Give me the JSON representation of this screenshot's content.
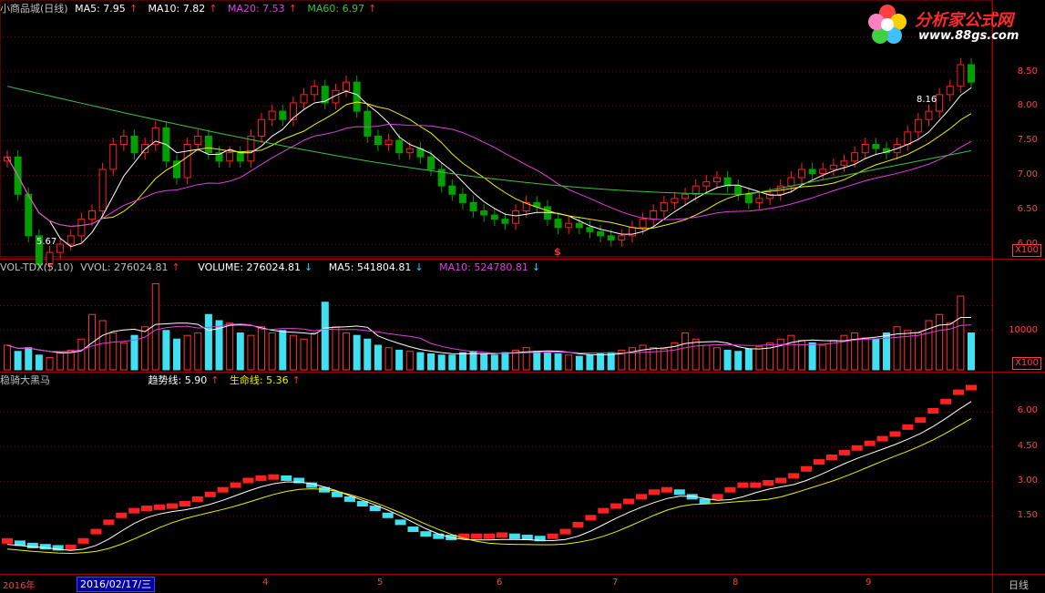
{
  "header": {
    "title": "小商品城(日线)",
    "ma5": "MA5: 7.95",
    "ma10": "MA10: 7.82",
    "ma20": "MA20: 7.53",
    "ma60": "MA60: 6.97",
    "arrow": "↑"
  },
  "logo": {
    "name": "分析家公式网",
    "url": "www.88gs.com"
  },
  "price_panel": {
    "y_ticks": [
      "8.50",
      "8.00",
      "7.50",
      "7.00",
      "6.50",
      "6.00"
    ],
    "high_label": "8.16",
    "low_label": "5.67",
    "marker": "$",
    "scale": "X100"
  },
  "volume_panel": {
    "title": "VOL-TDX(5,10)",
    "vvol": "VVOL: 276024.81",
    "volume": "VOLUME: 276024.81",
    "ma5": "MA5: 541804.81",
    "ma10": "MA10: 524780.81",
    "arrow_up": "↑",
    "arrow_down": "↓",
    "y_tick": "10000",
    "scale": "X100"
  },
  "indicator_panel": {
    "title": "稳骑大黑马",
    "trend": "趋势线: 5.90",
    "life": "生命线: 5.36",
    "arrow": "↑",
    "y_ticks": [
      "6.00",
      "4.50",
      "3.00",
      "1.50"
    ]
  },
  "x_axis": {
    "year": "2016年",
    "cursor_date": "2016/02/17/三",
    "months": [
      "4",
      "5",
      "6",
      "7",
      "8",
      "9"
    ],
    "period": "日线"
  },
  "colors": {
    "up": "#ff2020",
    "down": "#00a000",
    "vol_up": "#ff3030",
    "vol_down": "#40e0f0",
    "ma5": "#ffffff",
    "ma10": "#f0f000",
    "ma20": "#e040e0",
    "ma60": "#40c040",
    "grid": "#800000",
    "ind_up": "#ff2020",
    "ind_down": "#40e0f0"
  },
  "chart_data": {
    "type": "candlestick",
    "title": "小商品城(日线)",
    "ylim": [
      5.5,
      8.7
    ],
    "x_start": "2016-02",
    "x_end": "2016-09",
    "key_points": [
      {
        "label": "low",
        "value": 5.67
      },
      {
        "label": "high",
        "value": 8.16
      }
    ],
    "close_series": [
      7.05,
      6.6,
      6.1,
      5.75,
      5.9,
      6.0,
      6.1,
      6.3,
      6.4,
      6.9,
      7.2,
      7.3,
      7.1,
      7.2,
      7.4,
      7.0,
      6.8,
      7.2,
      7.3,
      7.1,
      7.0,
      7.1,
      7.0,
      7.3,
      7.5,
      7.6,
      7.5,
      7.7,
      7.8,
      7.9,
      7.7,
      7.85,
      7.95,
      7.6,
      7.3,
      7.2,
      7.25,
      7.1,
      7.15,
      7.05,
      6.9,
      6.7,
      6.6,
      6.5,
      6.4,
      6.35,
      6.3,
      6.25,
      6.4,
      6.5,
      6.45,
      6.3,
      6.2,
      6.25,
      6.2,
      6.15,
      6.1,
      6.05,
      6.1,
      6.2,
      6.3,
      6.4,
      6.5,
      6.55,
      6.6,
      6.7,
      6.75,
      6.8,
      6.7,
      6.6,
      6.5,
      6.55,
      6.6,
      6.7,
      6.8,
      6.9,
      6.85,
      6.9,
      6.95,
      7.0,
      7.1,
      7.2,
      7.15,
      7.1,
      7.2,
      7.35,
      7.5,
      7.6,
      7.8,
      7.9,
      8.16,
      7.95
    ],
    "volume_series": [
      20,
      15,
      18,
      12,
      10,
      14,
      16,
      25,
      45,
      40,
      30,
      22,
      28,
      35,
      70,
      32,
      25,
      28,
      30,
      45,
      40,
      38,
      30,
      28,
      35,
      30,
      32,
      28,
      25,
      30,
      55,
      35,
      30,
      28,
      25,
      20,
      18,
      16,
      15,
      14,
      13,
      12,
      12,
      14,
      15,
      13,
      12,
      14,
      16,
      18,
      15,
      14,
      13,
      12,
      11,
      12,
      13,
      14,
      16,
      18,
      20,
      18,
      17,
      22,
      30,
      25,
      20,
      18,
      16,
      15,
      17,
      19,
      22,
      25,
      28,
      24,
      22,
      20,
      24,
      28,
      30,
      26,
      25,
      30,
      35,
      32,
      30,
      40,
      45,
      38,
      60,
      30
    ],
    "indicator_series": [
      0.4,
      0.3,
      0.2,
      0.15,
      0.1,
      0.12,
      0.4,
      0.8,
      1.2,
      1.5,
      1.7,
      1.8,
      1.85,
      1.9,
      2.0,
      2.2,
      2.4,
      2.6,
      2.8,
      3.0,
      3.1,
      3.15,
      3.1,
      3.0,
      2.8,
      2.6,
      2.4,
      2.2,
      2.0,
      1.8,
      1.5,
      1.2,
      0.9,
      0.7,
      0.6,
      0.55,
      0.6,
      0.6,
      0.6,
      0.65,
      0.6,
      0.55,
      0.5,
      0.6,
      0.8,
      1.1,
      1.4,
      1.7,
      1.9,
      2.1,
      2.3,
      2.5,
      2.6,
      2.5,
      2.3,
      2.1,
      2.3,
      2.6,
      2.8,
      2.8,
      2.9,
      3.0,
      3.2,
      3.5,
      3.8,
      4.0,
      4.2,
      4.4,
      4.6,
      4.8,
      5.0,
      5.3,
      5.6,
      6.0,
      6.4,
      6.8,
      7.0
    ]
  }
}
